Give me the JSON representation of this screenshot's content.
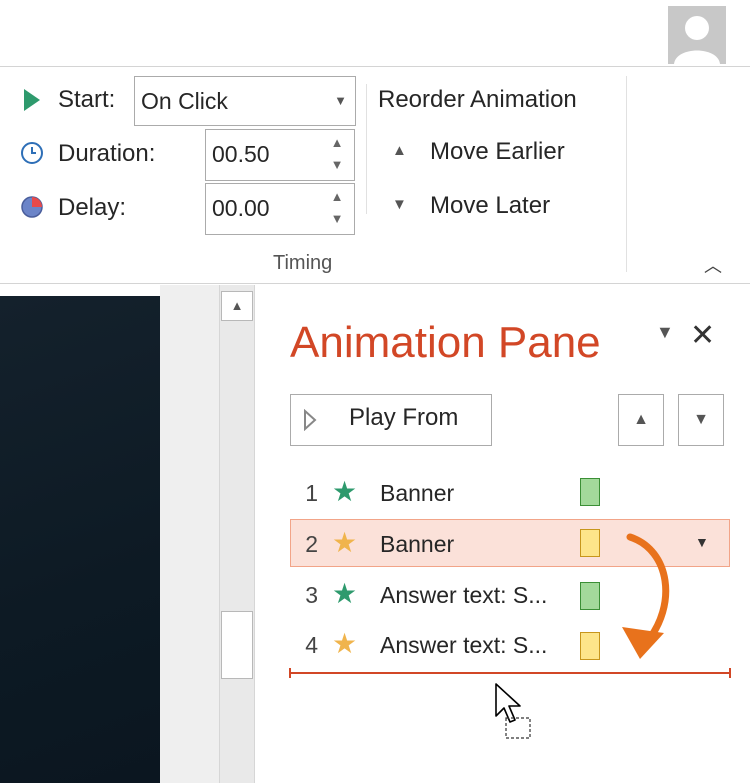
{
  "timing": {
    "start_label": "Start:",
    "start_value": "On Click",
    "duration_label": "Duration:",
    "duration_value": "00.50",
    "delay_label": "Delay:",
    "delay_value": "00.00",
    "group_label": "Timing"
  },
  "reorder": {
    "title": "Reorder Animation",
    "move_earlier": "Move Earlier",
    "move_later": "Move Later"
  },
  "animation_pane": {
    "title": "Animation Pane",
    "play_from": "Play From",
    "items": [
      {
        "number": "1",
        "icon": "green-star-icon",
        "label": "Banner",
        "bar_color": "#a3d99b"
      },
      {
        "number": "2",
        "icon": "gold-star-icon",
        "label": "Banner",
        "bar_color": "#fde58a",
        "selected": true
      },
      {
        "number": "3",
        "icon": "green-star-icon",
        "label": "Answer text: S...",
        "bar_color": "#a3d99b"
      },
      {
        "number": "4",
        "icon": "gold-star-icon",
        "label": "Answer text: S...",
        "bar_color": "#fde58a"
      }
    ]
  },
  "colors": {
    "accent": "#d24726",
    "drag_arrow": "#e8721c",
    "green_effect": "#2e9a6d",
    "gold_effect": "#f0b44c"
  }
}
